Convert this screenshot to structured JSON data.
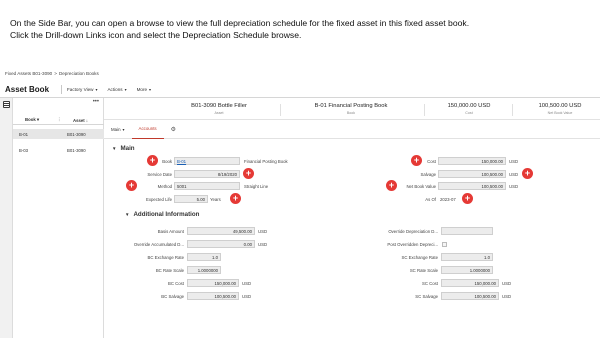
{
  "instruction": {
    "line1": "On the Side Bar, you can open a browse to view the full depreciation schedule for the fixed asset in this fixed asset book.",
    "line2": "Click the Drill-down Links icon and select the Depreciation Schedule browse."
  },
  "breadcrumb": {
    "item1": "Fixed Assets B01-3090",
    "separator": ">",
    "item2": "Depreciation Books"
  },
  "app": {
    "title": "Asset Book"
  },
  "menus": {
    "factory_view": "Factory View",
    "actions": "Actions",
    "more": "More",
    "caret": "▾"
  },
  "list": {
    "more": "•••",
    "col_book": "Book ▾",
    "col_asset": "Asset ↓",
    "col_sep": "⋮",
    "rows": [
      {
        "book": "B-01",
        "asset": "B01-3090"
      },
      {
        "book": "B-03",
        "asset": "B01-3090"
      }
    ]
  },
  "header": {
    "asset_value": "B01-3090  Bottle Filler",
    "asset_label": "Asset",
    "book_value": "B-01  Financial Posting Book",
    "book_label": "Book",
    "cost_value": "150,000.00  USD",
    "cost_label": "Cost",
    "nbv_value": "100,500.00  USD",
    "nbv_label": "Net Book Value"
  },
  "tabs": {
    "main": "Main",
    "main_caret": "▾",
    "accounts": "Accounts",
    "gear": "⚙"
  },
  "main_section": {
    "title": "Main",
    "chevron": "▼",
    "book_label": "Book",
    "book_value": "B-01",
    "book_desc": "Financial Posting Book",
    "service_date_label": "Service Date",
    "service_date_value": "8/19/2020",
    "method_label": "Method",
    "method_value": "5001",
    "method_desc": "Straight Line",
    "expected_life_label": "Expected Life",
    "expected_life_value": "5.00",
    "expected_life_unit": "Years",
    "cost_label": "Cost",
    "cost_value": "150,000.00",
    "cost_currency": "USD",
    "salvage_label": "Salvage",
    "salvage_value": "100,500.00",
    "salvage_currency": "USD",
    "nbv_label": "Net Book Value",
    "nbv_value": "100,500.00",
    "nbv_currency": "USD",
    "as_of_label": "As Of",
    "as_of_value": "2023-07"
  },
  "additional": {
    "title": "Additional Information",
    "chevron": "▼",
    "basis_amount_label": "Basis Amount",
    "basis_amount_value": "49,500.00",
    "basis_currency": "USD",
    "override_accum_label": "Override Accumulated D...",
    "override_accum_value": "0.00",
    "override_accum_currency": "USD",
    "bc_exchange_rate_label": "BC Exchange Rate",
    "bc_exchange_rate_value": "1.0",
    "bc_rate_scale_label": "BC Rate Scale",
    "bc_rate_scale_value": "1.0000000",
    "bc_cost_label": "BC Cost",
    "bc_cost_value": "150,000.00",
    "bc_cost_currency": "USD",
    "bc_salvage_label": "BC Salvage",
    "bc_salvage_value": "100,500.00",
    "bc_salvage_currency": "USD",
    "override_dep_label": "Override Depreciation D...",
    "post_overridden_label": "Post Overridden Depreci...",
    "sc_exchange_rate_label": "SC Exchange Rate",
    "sc_exchange_rate_value": "1.0",
    "sc_rate_scale_label": "SC Rate Scale",
    "sc_rate_scale_value": "1.0000000",
    "sc_cost_label": "SC Cost",
    "sc_cost_value": "150,000.00",
    "sc_cost_currency": "USD",
    "sc_salvage_label": "SC Salvage",
    "sc_salvage_value": "100,500.00",
    "sc_salvage_currency": "USD"
  },
  "markers": {
    "plus": "+"
  },
  "colors": {
    "accent_red": "#e53935",
    "field_bg": "#ececec",
    "link_blue": "#1a5fb4"
  }
}
